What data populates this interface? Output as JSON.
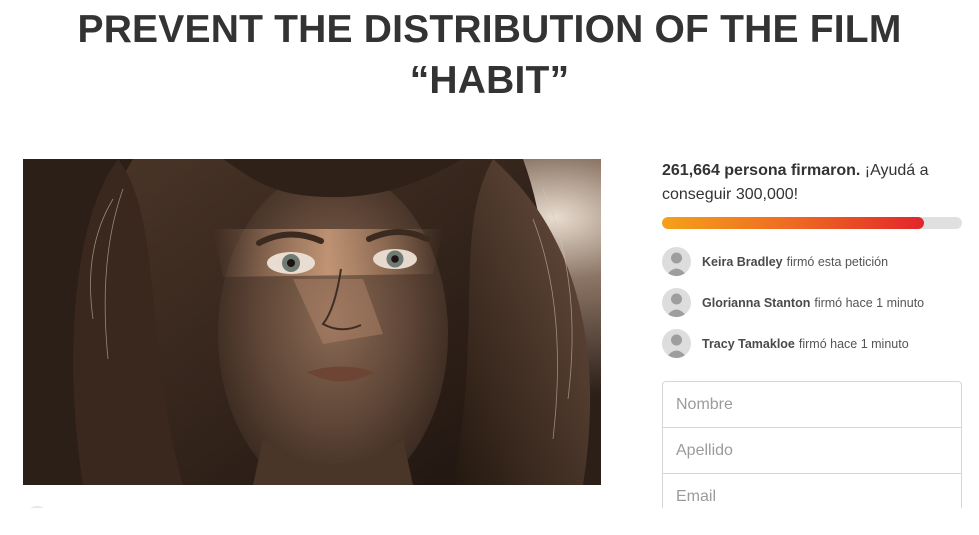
{
  "petition": {
    "title_line1": "PREVENT THE DISTRIBUTION OF THE FILM",
    "title_line2": "“HABIT”"
  },
  "signatures": {
    "count_bold": "261,664 persona firmaron.",
    "count_cta": " ¡Ayudá a conseguir 300,000!",
    "progress_fraction": 0.8722
  },
  "recent_signers": [
    {
      "name": "Keira Bradley",
      "action": "firmó esta petición"
    },
    {
      "name": "Glorianna Stanton",
      "action": "firmó hace 1 minuto"
    },
    {
      "name": "Tracy Tamakloe",
      "action": "firmó hace 1 minuto"
    }
  ],
  "form": {
    "first_name_placeholder": "Nombre",
    "last_name_placeholder": "Apellido",
    "email_placeholder": "Email"
  },
  "colors": {
    "progress_start": "#f4a11a",
    "progress_end": "#e2262a",
    "text": "#333333"
  },
  "icons": {
    "signer_avatar": "default-user-avatar-icon"
  }
}
